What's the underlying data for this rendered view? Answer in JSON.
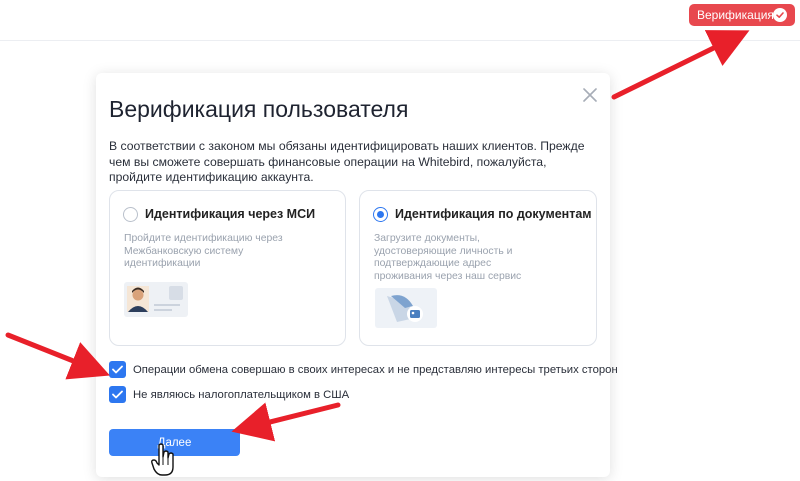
{
  "header": {
    "verify_badge_label": "Верификация",
    "verify_badge_color": "#e8484e"
  },
  "modal": {
    "title": "Верификация пользователя",
    "description": "В соответствии с законом мы обязаны идентифицировать наших клиентов. Прежде чем вы сможете совершать финансовые операции на Whitebird, пожалуйста, пройдите идентификацию аккаунта.",
    "options": [
      {
        "title": "Идентификация через МСИ",
        "description": "Пройдите идентификацию через Межбанковскую систему идентификации",
        "selected": false
      },
      {
        "title": "Идентификация по документам",
        "description": "Загрузите документы, удостоверяющие личность и подтверждающие адрес проживания через наш сервис",
        "selected": true
      }
    ],
    "checkboxes": [
      {
        "label": "Операции обмена совершаю в своих интересах и не представляю интересы третьих сторон",
        "checked": true
      },
      {
        "label": "Не являюсь налогоплательщиком в США",
        "checked": true
      }
    ],
    "next_button_label": "Далее"
  },
  "colors": {
    "accent": "#3b82f6",
    "radio_selected": "#2d77f0",
    "annotation_arrow": "#e8202a"
  },
  "icons": [
    "check-circle-icon",
    "close-icon",
    "radio-icon",
    "checkbox-check-icon",
    "id-card-icon",
    "document-icon",
    "hand-pointer-icon",
    "annotation-arrow-icon"
  ]
}
